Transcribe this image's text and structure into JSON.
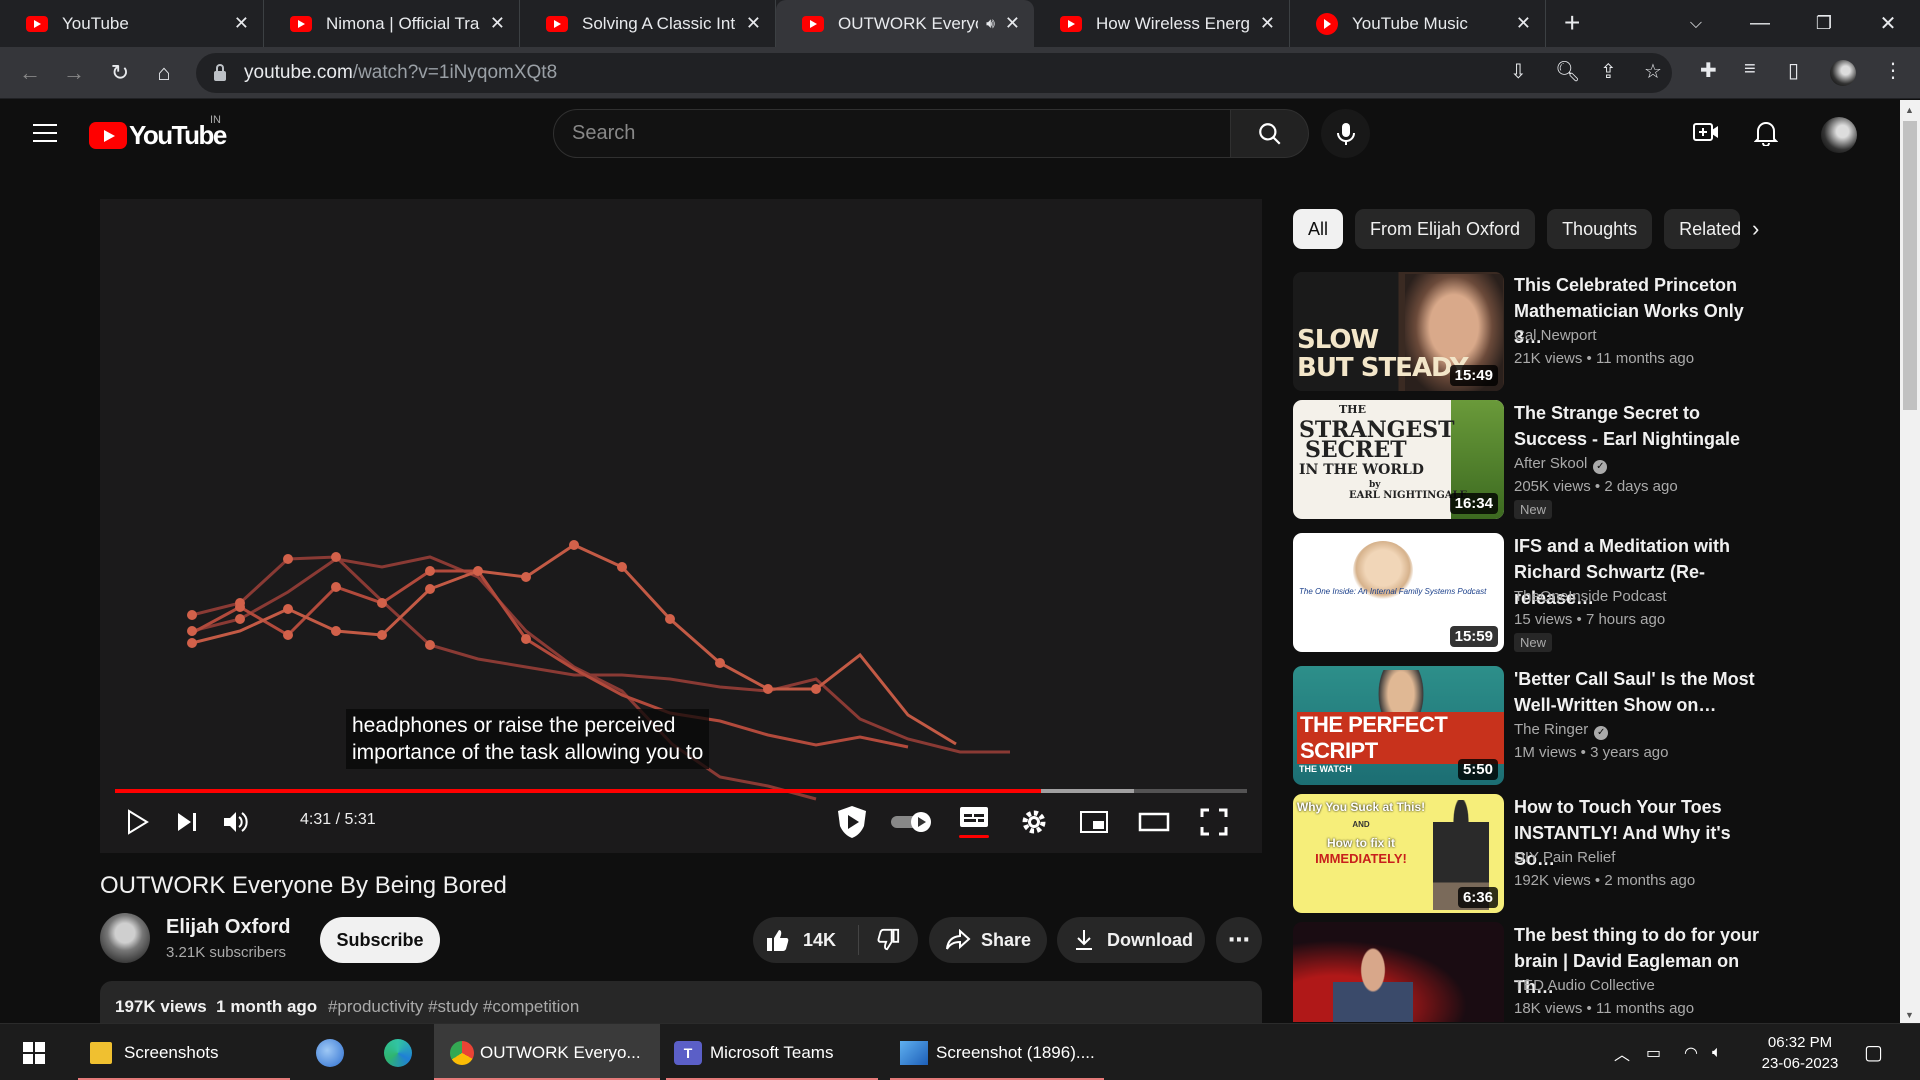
{
  "browser": {
    "tabs": [
      {
        "title": "YouTube",
        "icon": "youtube-favicon"
      },
      {
        "title": "Nimona | Official Traile",
        "icon": "youtube-favicon"
      },
      {
        "title": "Solving A Classic Interv",
        "icon": "youtube-favicon"
      },
      {
        "title": "OUTWORK Everyo",
        "icon": "youtube-favicon",
        "active": true,
        "audio": true
      },
      {
        "title": "How Wireless Energy F",
        "icon": "youtube-favicon"
      },
      {
        "title": "YouTube Music",
        "icon": "youtube-music-favicon"
      }
    ],
    "url_host": "youtube.com",
    "url_path": "/watch?v=1iNyqomXQt8"
  },
  "masthead": {
    "logo_text": "YouTube",
    "country_code": "IN",
    "search_placeholder": "Search"
  },
  "player": {
    "captions": [
      "headphones or raise the perceived",
      "importance of the task allowing you to"
    ],
    "time_current": "4:31",
    "time_total": "5:31",
    "progress": 0.818,
    "buffered": 0.9
  },
  "video": {
    "title": "OUTWORK Everyone By Being Bored",
    "channel": "Elijah Oxford",
    "subscribers": "3.21K subscribers",
    "subscribe_label": "Subscribe",
    "likes": "14K",
    "share_label": "Share",
    "download_label": "Download",
    "views": "197K views",
    "age": "1 month ago",
    "hashtags": "#productivity #study #competition"
  },
  "sidebar": {
    "chips": [
      "All",
      "From Elijah Oxford",
      "Thoughts",
      "Related"
    ],
    "recommendations": [
      {
        "title": "This Celebrated Princeton Mathematician Works Only 3…",
        "channel": "Cal Newport",
        "verified": false,
        "views": "21K views",
        "age": "11 months ago",
        "duration": "15:49",
        "new": false,
        "thumb_text": [
          "SLOW",
          "BUT STEADY"
        ]
      },
      {
        "title": "The Strange Secret to Success - Earl Nightingale",
        "channel": "After Skool",
        "verified": true,
        "views": "205K views",
        "age": "2 days ago",
        "duration": "16:34",
        "new": true,
        "thumb_text": [
          "THE",
          "STRANGEST",
          "SECRET",
          "IN THE WORLD",
          "by",
          "EARL NIGHTINGALE"
        ]
      },
      {
        "title": "IFS and a Meditation with Richard Schwartz (Re-release…",
        "channel": "TheOneInside Podcast",
        "verified": false,
        "views": "15 views",
        "age": "7 hours ago",
        "duration": "15:59",
        "new": true,
        "thumb_text": [
          "The One Inside: An Internal Family Systems Podcast"
        ]
      },
      {
        "title": "'Better Call Saul' Is the Most Well-Written Show on…",
        "channel": "The Ringer",
        "verified": true,
        "views": "1M views",
        "age": "3 years ago",
        "duration": "5:50",
        "new": false,
        "thumb_text": [
          "THE PERFECT SCRIPT",
          "THE WATCH"
        ]
      },
      {
        "title": "How to Touch Your Toes INSTANTLY! And Why it's So…",
        "channel": "DIY Pain Relief",
        "verified": false,
        "views": "192K views",
        "age": "2 months ago",
        "duration": "6:36",
        "new": false,
        "thumb_text": [
          "Why You Suck at This!",
          "AND",
          "How to fix it",
          "IMMEDIATELY!"
        ]
      },
      {
        "title": "The best thing to do for your brain | David Eagleman on Th…",
        "channel": "TED Audio Collective",
        "verified": false,
        "views": "18K views",
        "age": "11 months ago",
        "duration": "",
        "new": false,
        "thumb_text": []
      }
    ],
    "new_label": "New"
  },
  "taskbar": {
    "apps": [
      {
        "label": "Screenshots",
        "icon": "folder-icon"
      },
      {
        "label": "",
        "icon": "outlook-icon"
      },
      {
        "label": "",
        "icon": "edge-icon"
      },
      {
        "label": "OUTWORK Everyo...",
        "icon": "chrome-icon",
        "active": true
      },
      {
        "label": "Microsoft Teams",
        "icon": "teams-icon"
      },
      {
        "label": "Screenshot (1896)....",
        "icon": "photos-icon"
      }
    ],
    "time": "06:32 PM",
    "date": "23-06-2023"
  },
  "colors": {
    "youtube_red": "#ff0000",
    "background": "#0f0f0f",
    "chip": "#272727"
  }
}
